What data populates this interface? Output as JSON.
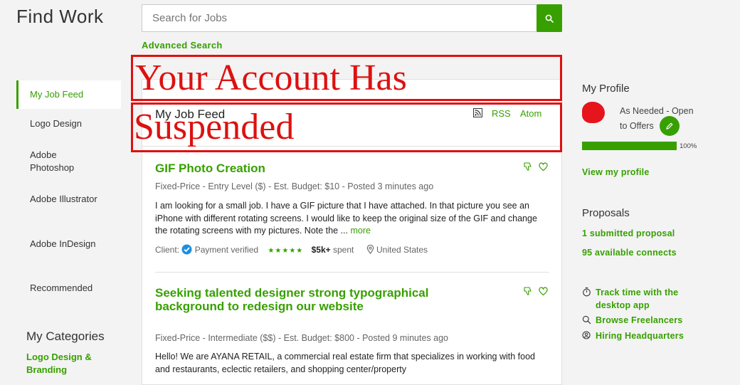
{
  "header": {
    "page_title": "Find Work",
    "search_placeholder": "Search for Jobs",
    "advanced_search": "Advanced Search"
  },
  "sidebar": {
    "items": [
      {
        "label": "My Job Feed",
        "active": true
      },
      {
        "label": "Logo Design"
      },
      {
        "label": "Adobe Photoshop"
      },
      {
        "label": "Adobe Illustrator"
      },
      {
        "label": "Adobe InDesign"
      },
      {
        "label": "Recommended"
      }
    ],
    "categories_title": "My Categories",
    "categories": [
      "Logo Design & Branding"
    ]
  },
  "feed": {
    "title": "My Job Feed",
    "rss": "RSS",
    "atom": "Atom",
    "jobs": [
      {
        "title": "GIF Photo Creation",
        "meta": "Fixed-Price - Entry Level ($) - Est. Budget: $10 - Posted 3 minutes ago",
        "description": "I am looking for a small job. I have a GIF picture that I have attached. In that picture you see an iPhone with different rotating screens. I would like to keep the original size of the GIF and change the rotating screens with my pictures. Note the ...",
        "more": "more",
        "client_label": "Client:",
        "payment": "Payment verified",
        "stars": "★★★★★",
        "spent_amount": "$5k+",
        "spent_label": "spent",
        "location": "United States"
      },
      {
        "title": "Seeking talented designer strong typographical background to redesign our website",
        "meta": "Fixed-Price - Intermediate ($$) - Est. Budget: $800 - Posted 9 minutes ago",
        "description": "Hello! We are AYANA RETAIL, a commercial real estate firm that specializes in working with food and restaurants, eclectic retailers, and shopping center/property"
      }
    ]
  },
  "overlay": {
    "line1": "Your Account Has",
    "line2": "Suspended",
    "color": "#dd1111"
  },
  "profile": {
    "title": "My Profile",
    "availability": "As Needed - Open to Offers",
    "progress_value": 100,
    "progress_label": "100%",
    "view_link": "View my profile"
  },
  "proposals": {
    "title": "Proposals",
    "submitted": "1 submitted proposal",
    "connects": "95 available connects"
  },
  "links": [
    {
      "icon": "stopwatch-icon",
      "label": "Track time with the desktop app"
    },
    {
      "icon": "search-icon",
      "label": "Browse Freelancers"
    },
    {
      "icon": "user-search-icon",
      "label": "Hiring Headquarters"
    }
  ],
  "colors": {
    "accent": "#37a000",
    "background": "#f3f3f3"
  }
}
